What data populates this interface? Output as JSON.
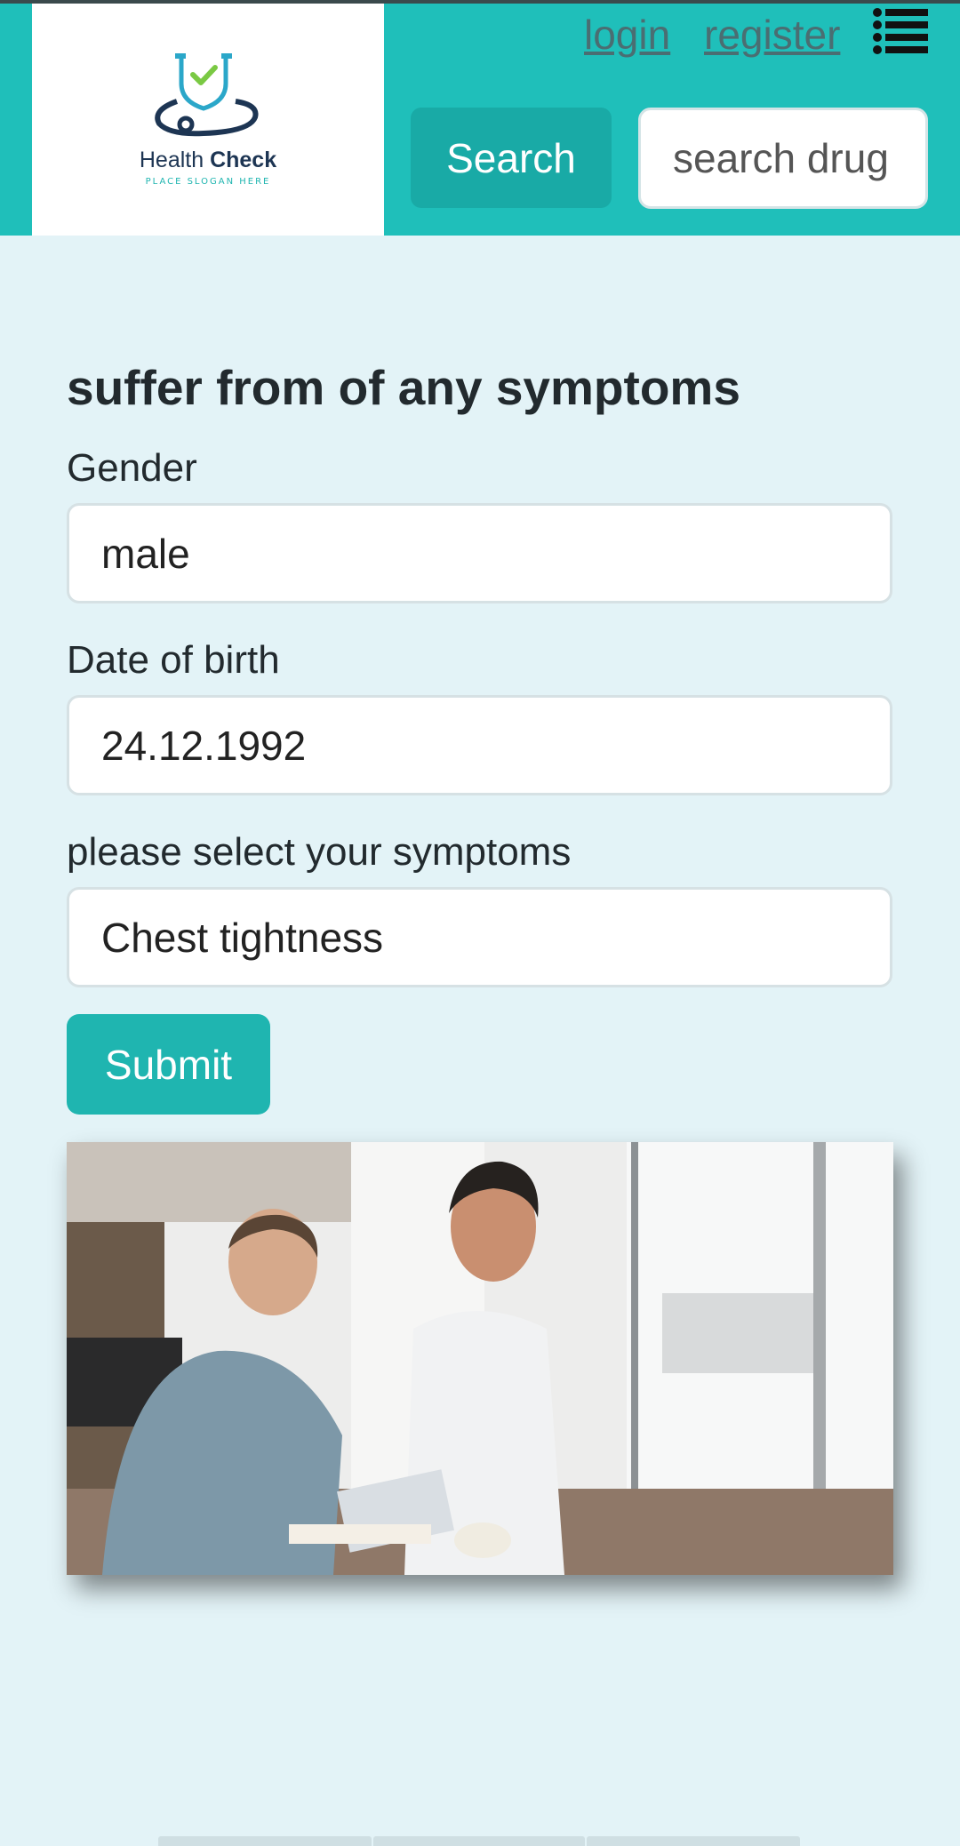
{
  "brand": {
    "name_regular": "Health ",
    "name_bold": "Check",
    "slogan": "PLACE SLOGAN HERE"
  },
  "header": {
    "login_label": "login",
    "register_label": "register",
    "search_button_label": "Search",
    "search_placeholder": "search drug"
  },
  "form": {
    "title": "suffer from of any symptoms",
    "gender_label": "Gender",
    "gender_value": "male",
    "dob_label": "Date of birth",
    "dob_value": "24.12.1992",
    "symptoms_label": "please select your symptoms",
    "symptoms_value": "Chest tightness",
    "submit_label": "Submit"
  },
  "colors": {
    "header_bg": "#1fbfba",
    "page_bg": "#e3f3f7",
    "accent_button": "#1fb5b0"
  },
  "icons": [
    "stethoscope-shield-logo",
    "menu-list-icon"
  ]
}
